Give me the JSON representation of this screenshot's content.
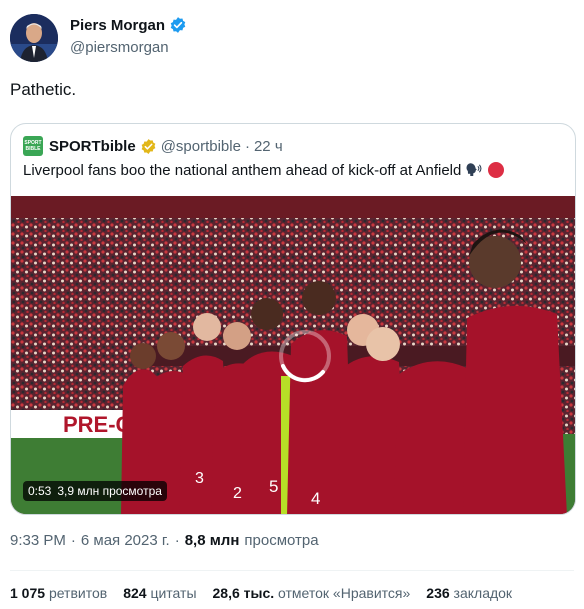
{
  "author": {
    "name": "Piers Morgan",
    "handle": "@piersmorgan"
  },
  "tweet_text": "Pathetic.",
  "quote": {
    "name": "SPORTbible",
    "handle": "@sportbible",
    "separator": "·",
    "time": "22 ч",
    "text": "Liverpool fans boo the national anthem ahead of kick-off at Anfield",
    "logo_text": "SPORT BIBLE",
    "media": {
      "banner_text": "PRE-C",
      "video_time": "0:53",
      "video_views": "3,9 млн просмотра"
    }
  },
  "meta": {
    "time": "9:33 PM",
    "dot": "·",
    "date": "6 мая 2023 г.",
    "dot2": "·",
    "views_count": "8,8 млн",
    "views_label": "просмотра"
  },
  "stats": {
    "retweets_count": "1 075",
    "retweets_label": "ретвитов",
    "quotes_count": "824",
    "quotes_label": "цитаты",
    "likes_count": "28,6 тыс.",
    "likes_label": "отметок «Нравится»",
    "bookmarks_count": "236",
    "bookmarks_label": "закладок"
  },
  "colors": {
    "verified_blue": "#1d9bf0",
    "verified_gold": "#e2b719",
    "text_primary": "#0f1419",
    "text_secondary": "#536471",
    "border": "#cfd9de",
    "liverpool_red": "#a5122a"
  }
}
